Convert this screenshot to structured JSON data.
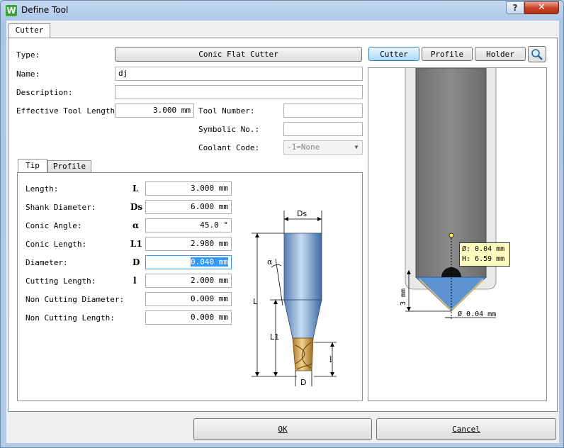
{
  "window": {
    "title": "Define Tool",
    "icon_letter": "W",
    "help_label": "?",
    "close_label": "✕"
  },
  "tabs": {
    "cutter": "Cutter"
  },
  "form": {
    "type_label": "Type:",
    "type_value": "Conic Flat Cutter",
    "name_label": "Name:",
    "name_value": "dj",
    "description_label": "Description:",
    "description_value": "",
    "effective_length_label": "Effective Tool Length:",
    "effective_length_value": "3.000 mm",
    "tool_number_label": "Tool Number:",
    "tool_number_value": "",
    "symbolic_label": "Symbolic No.:",
    "symbolic_value": "",
    "coolant_label": "Coolant Code:",
    "coolant_value": "-1=None"
  },
  "subtabs": {
    "tip": "Tip",
    "profile": "Profile"
  },
  "params": [
    {
      "label": "Length:",
      "sym": "L",
      "value": "3.000 mm"
    },
    {
      "label": "Shank Diameter:",
      "sym": "Ds",
      "value": "6.000 mm"
    },
    {
      "label": "Conic Angle:",
      "sym": "α",
      "value": "45.0 °"
    },
    {
      "label": "Conic Length:",
      "sym": "L1",
      "value": "2.980 mm"
    },
    {
      "label": "Diameter:",
      "sym": "D",
      "value": "0.040 mm"
    },
    {
      "label": "Cutting Length:",
      "sym": "l",
      "value": "2.000 mm"
    },
    {
      "label": "Non Cutting Diameter:",
      "sym": "",
      "value": "0.000 mm"
    },
    {
      "label": "Non Cutting Length:",
      "sym": "",
      "value": "0.000 mm"
    }
  ],
  "diagram": {
    "ds": "Ds",
    "alpha": "α",
    "L": "L",
    "L1": "L1",
    "l": "l",
    "D": "D"
  },
  "view_buttons": {
    "cutter": "Cutter",
    "profile": "Profile",
    "holder": "Holder"
  },
  "preview": {
    "tooltip_line1": "Ø: 0.04 mm",
    "tooltip_line2": "H: 6.59 mm",
    "dim_height": "3 mm",
    "dim_diameter": "Ø 0.04 mm"
  },
  "footer": {
    "ok": "OK",
    "cancel": "Cancel"
  }
}
